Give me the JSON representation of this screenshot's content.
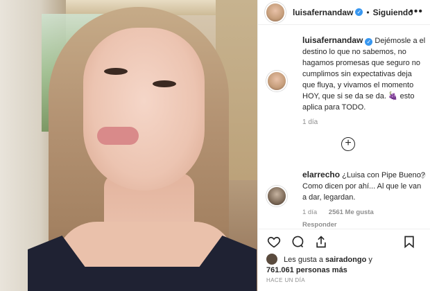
{
  "post": {
    "author": "luisafernandaw",
    "follow_separator": "•",
    "follow_label": "Siguiendo",
    "more_label": "•••",
    "caption": "Dejémosle a el destino lo que no sabemos, no hagamos promesas que seguro no cumplimos sin expectativas deja que fluya, y vivamos el momento HOY, que si se da se da. 🍇 esto aplica para TODO.",
    "caption_time": "1 día",
    "load_more_symbol": "+"
  },
  "comment": {
    "author": "elarrecho",
    "text": "¿Luisa con Pipe Bueno? Como dicen por ahí... Al que le van a dar, legardan.",
    "time": "1 día",
    "likes": "2561 Me gusta",
    "reply_label": "Responder"
  },
  "actions": {
    "like_icon": "heart-icon",
    "comment_icon": "comment-icon",
    "share_icon": "share-icon",
    "save_icon": "bookmark-icon"
  },
  "likes": {
    "prefix": "Les gusta a",
    "user": "sairadongo",
    "connector": "y",
    "count": "761.061 personas más"
  },
  "posted_label": "Hace un día",
  "colors": {
    "verified": "#3897f0",
    "secondary_text": "#8e8e8e",
    "primary_text": "#262626"
  }
}
